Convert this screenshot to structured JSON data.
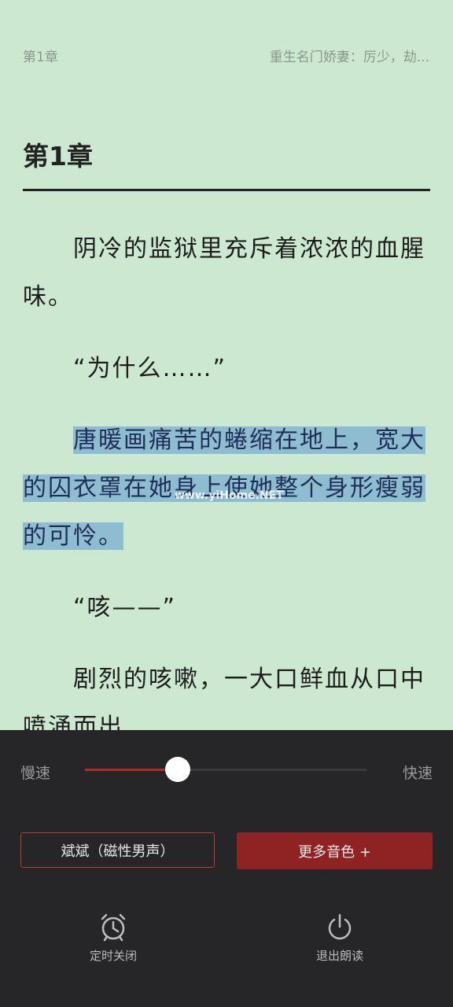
{
  "header": {
    "chapter_short": "第1章",
    "book_title": "重生名门娇妻：厉少，劫..."
  },
  "chapter_title": "第1章",
  "paragraphs": {
    "p1": "阴冷的监狱里充斥着浓浓的血腥味。",
    "p2": "“为什么……”",
    "p3": "唐暖画痛苦的蜷缩在地上，宽大的囚衣罩在她身上使她整个身形瘦弱的可怜。",
    "p4": "“咳——”",
    "p5": "剧烈的咳嗽，一大口鲜血从口中喷涌而出"
  },
  "watermark": "www.yiHome.NET",
  "player": {
    "slow_label": "慢速",
    "fast_label": "快速",
    "speed_level": 0.33,
    "voice_label": "斌斌（磁性男声）",
    "more_voices_label": "更多音色 +",
    "timer_label": "定时关闭",
    "exit_label": "退出朗读",
    "timer_icon": "alarm-clock-icon",
    "exit_icon": "power-icon",
    "accent_color": "#b32a2a"
  }
}
